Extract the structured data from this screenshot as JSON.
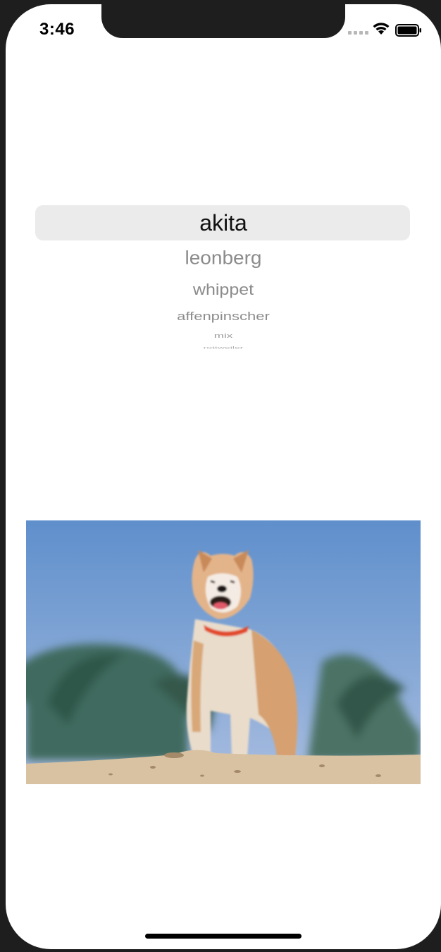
{
  "status_bar": {
    "time": "3:46",
    "icons": [
      "signal-icon",
      "wifi-icon",
      "battery-icon"
    ]
  },
  "picker": {
    "items": [
      "akita",
      "leonberg",
      "whippet",
      "affenpinscher",
      "mix",
      "rottweiler"
    ],
    "selected": "akita"
  },
  "image": {
    "subject": "akita dog on sand dune",
    "icon": "dog-photo"
  },
  "colors": {
    "picker_highlight": "#ebebeb",
    "selected_text": "#111111",
    "unselected_text": "#8b8b8b",
    "sky": "#6d97c9",
    "sand": "#d8c2a2"
  }
}
